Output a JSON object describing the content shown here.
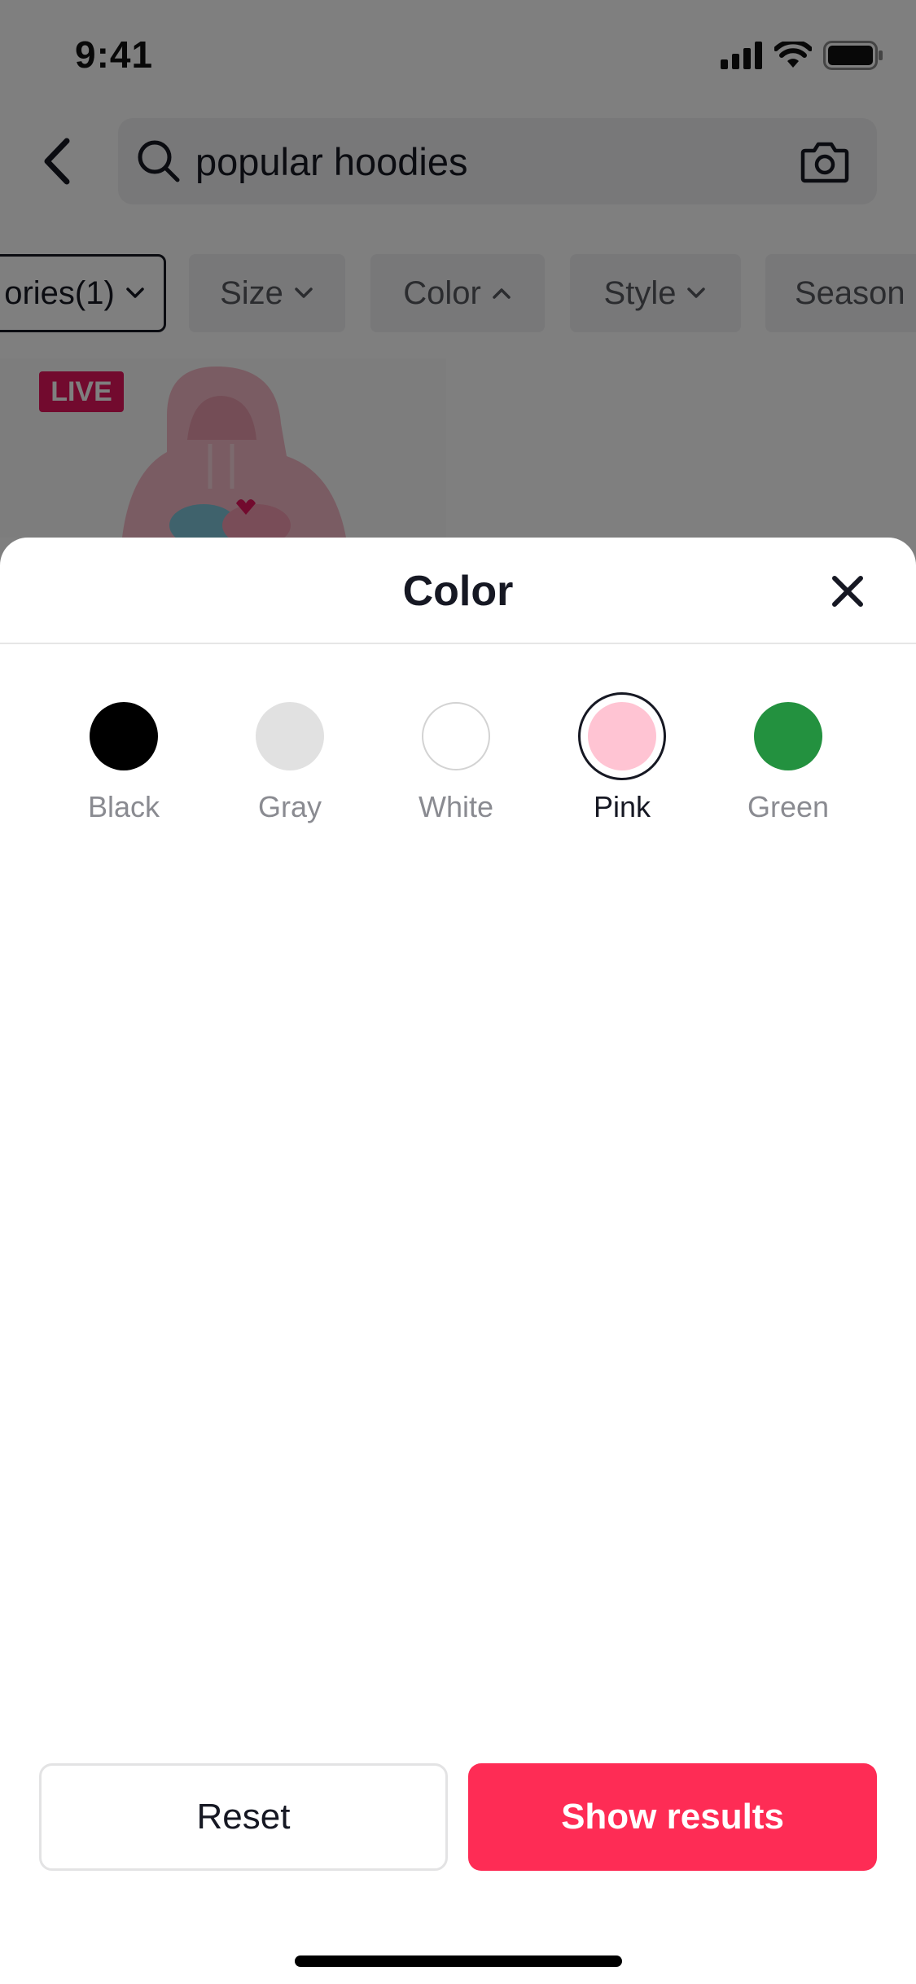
{
  "status_bar": {
    "time": "9:41",
    "icons": [
      "cellular-signal-icon",
      "wifi-icon",
      "battery-icon"
    ]
  },
  "search": {
    "query": "popular hoodies",
    "icons": [
      "back-arrow-icon",
      "search-icon",
      "camera-icon"
    ]
  },
  "filter_chips": [
    {
      "label": "ories(1)",
      "active": true
    },
    {
      "label": "Size",
      "active": false
    },
    {
      "label": "Color",
      "active": false,
      "expanded": true
    },
    {
      "label": "Style",
      "active": false
    },
    {
      "label": "Season",
      "active": false
    }
  ],
  "product": {
    "badge": "LIVE"
  },
  "sheet": {
    "title": "Color",
    "colors": [
      {
        "name": "Black",
        "hex": "#000000",
        "selected": false
      },
      {
        "name": "Gray",
        "hex": "#e1e1e1",
        "selected": false
      },
      {
        "name": "White",
        "hex": "#ffffff",
        "selected": false
      },
      {
        "name": "Pink",
        "hex": "#ffc4d3",
        "selected": true
      },
      {
        "name": "Green",
        "hex": "#23913f",
        "selected": false
      }
    ],
    "reset_label": "Reset",
    "show_results_label": "Show results"
  },
  "theme": {
    "accent": "#fe2c55",
    "live_badge": "#e5155c"
  }
}
